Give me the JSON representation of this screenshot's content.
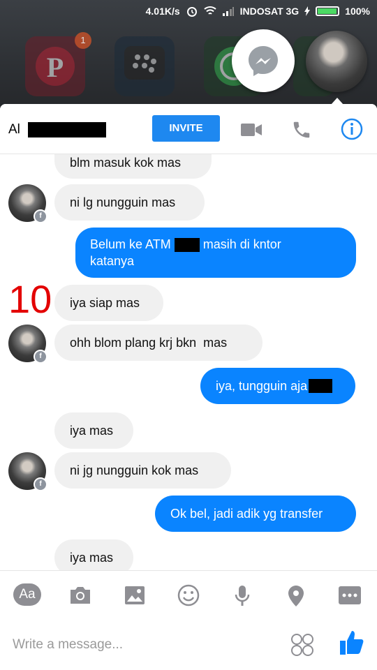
{
  "status_bar": {
    "speed": "4.01K/s",
    "carrier": "INDOSAT 3G",
    "battery": "100%"
  },
  "background_apps": {
    "pinterest_badge": "1"
  },
  "chat": {
    "contact_name": "Al",
    "invite_label": "INVITE",
    "annotation_number": "10",
    "messages": [
      {
        "dir": "in",
        "text": "blm masuk kok mas"
      },
      {
        "dir": "in",
        "text": "ni lg nungguin mas"
      },
      {
        "dir": "out",
        "text_before": "Belum ke ATM",
        "text_after": " masih di kntor",
        "line2": "katanya"
      },
      {
        "dir": "in",
        "text": "iya siap mas"
      },
      {
        "dir": "in",
        "text": "ohh blom plang krj bkn  mas"
      },
      {
        "dir": "out",
        "text": "iya, tungguin aja"
      },
      {
        "dir": "in",
        "text": "iya mas"
      },
      {
        "dir": "in",
        "text": "ni jg nungguin kok mas"
      },
      {
        "dir": "out",
        "text": "Ok bel, jadi adik yg transfer"
      },
      {
        "dir": "in",
        "text": "iya mas"
      }
    ]
  },
  "toolbar": {
    "aa_label": "Aa"
  },
  "composer": {
    "placeholder": "Write a message..."
  },
  "colors": {
    "accent": "#0a84ff",
    "invite_bg": "#1e88f0",
    "incoming_bg": "#f0f0f0",
    "annotation": "#e30000"
  }
}
